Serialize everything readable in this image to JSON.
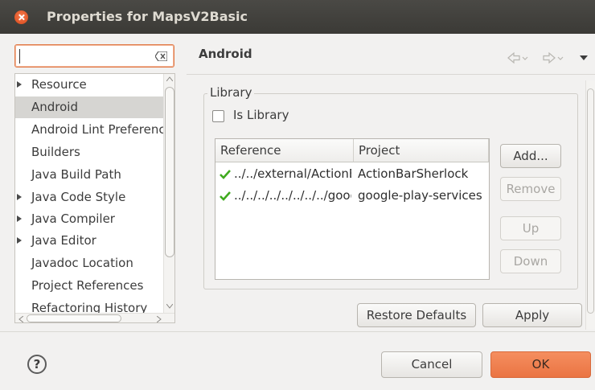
{
  "window": {
    "title": "Properties for MapsV2Basic"
  },
  "filter": {
    "value": ""
  },
  "tree": {
    "items": [
      {
        "label": "Resource",
        "expandable": true,
        "selected": false
      },
      {
        "label": "Android",
        "expandable": false,
        "selected": true
      },
      {
        "label": "Android Lint Preferences",
        "expandable": false,
        "selected": false
      },
      {
        "label": "Builders",
        "expandable": false,
        "selected": false
      },
      {
        "label": "Java Build Path",
        "expandable": false,
        "selected": false
      },
      {
        "label": "Java Code Style",
        "expandable": true,
        "selected": false
      },
      {
        "label": "Java Compiler",
        "expandable": true,
        "selected": false
      },
      {
        "label": "Java Editor",
        "expandable": true,
        "selected": false
      },
      {
        "label": "Javadoc Location",
        "expandable": false,
        "selected": false
      },
      {
        "label": "Project References",
        "expandable": false,
        "selected": false
      },
      {
        "label": "Refactoring History",
        "expandable": false,
        "selected": false
      }
    ]
  },
  "page": {
    "title": "Android"
  },
  "library": {
    "group_label": "Library",
    "is_library_label": "Is Library",
    "is_library_checked": false,
    "columns": [
      "Reference",
      "Project"
    ],
    "rows": [
      {
        "reference": "../../external/ActionBarSherlock",
        "project": "ActionBarSherlock",
        "valid": true
      },
      {
        "reference": "../../../../../../../../google-play-services",
        "project": "google-play-services",
        "valid": true
      }
    ],
    "buttons": {
      "add": "Add...",
      "remove": "Remove",
      "up": "Up",
      "down": "Down"
    }
  },
  "actions": {
    "restore_defaults": "Restore Defaults",
    "apply": "Apply",
    "cancel": "Cancel",
    "ok": "OK",
    "help": "?"
  },
  "colors": {
    "accent": "#ea7443",
    "check": "#3faa1e",
    "titlebar": "#3b3a36"
  }
}
